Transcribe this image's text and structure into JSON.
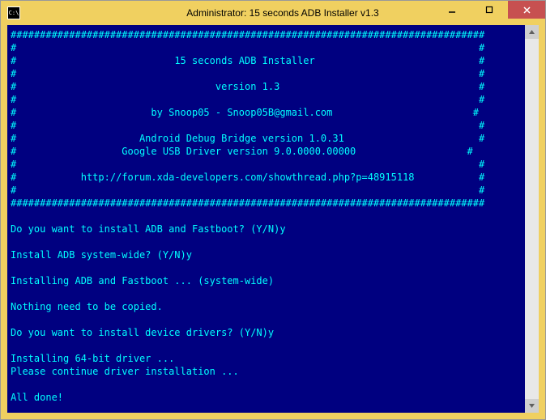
{
  "window": {
    "title": "Administrator:  15 seconds ADB Installer v1.3",
    "icon_label": "C:\\"
  },
  "banner": {
    "border_top": "#################################################################################",
    "border_bottom": "#################################################################################",
    "side": "#",
    "title": "15 seconds ADB Installer",
    "version": "version 1.3",
    "author": "by Snoop05 - Snoop05B@gmail.com",
    "adb_version": "Android Debug Bridge version 1.0.31",
    "usb_driver": "Google USB Driver version 9.0.0000.00000",
    "url": "http://forum.xda-developers.com/showthread.php?p=48915118"
  },
  "log": {
    "q1": "Do you want to install ADB and Fastboot? (Y/N)y",
    "q2": "Install ADB system-wide? (Y/N)y",
    "s1": "Installing ADB and Fastboot ... (system-wide)",
    "s2": "Nothing need to be copied.",
    "q3": "Do you want to install device drivers? (Y/N)y",
    "s3": "Installing 64-bit driver ...",
    "s4": "Please continue driver installation ...",
    "done": "All done!"
  }
}
